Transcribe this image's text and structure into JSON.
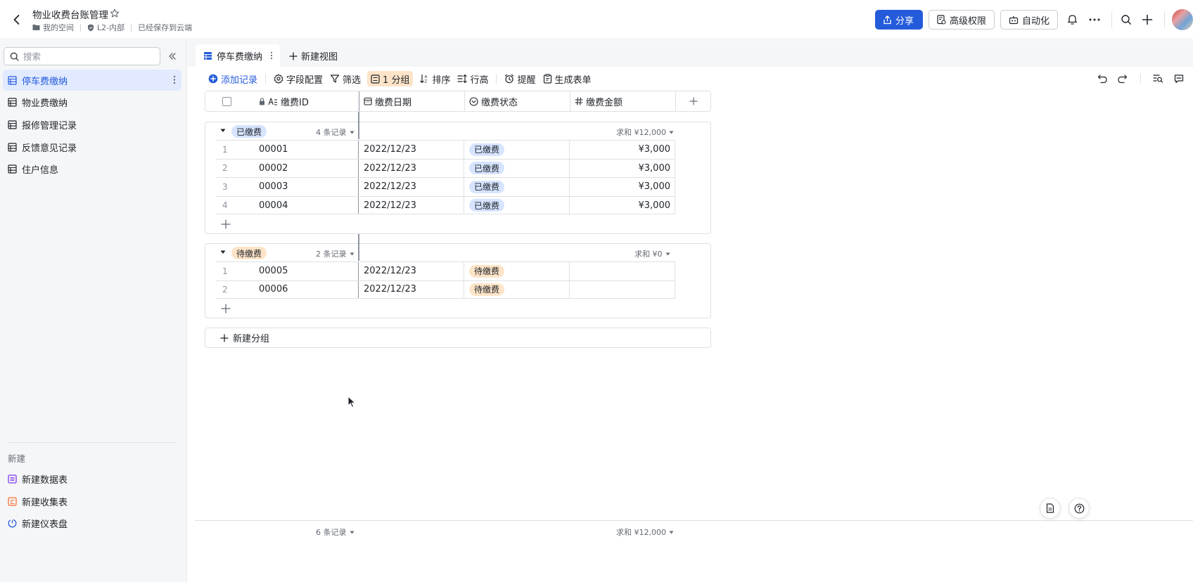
{
  "header": {
    "title": "物业收费台账管理",
    "location": "我的空间",
    "security": "L2-内部",
    "save_status": "已经保存到云端",
    "share_label": "分享",
    "permission_label": "高级权限",
    "automation_label": "自动化"
  },
  "sidebar": {
    "search_placeholder": "搜索",
    "items": [
      {
        "label": "停车费缴纳",
        "active": true
      },
      {
        "label": "物业费缴纳"
      },
      {
        "label": "报修管理记录"
      },
      {
        "label": "反馈意见记录"
      },
      {
        "label": "住户信息"
      }
    ],
    "new_title": "新建",
    "new_items": [
      {
        "label": "新建数据表",
        "icon": "table-icon",
        "color": "#7f3bf5"
      },
      {
        "label": "新建收集表",
        "icon": "form-icon",
        "color": "#f77234"
      },
      {
        "label": "新建仪表盘",
        "icon": "dashboard-icon",
        "color": "#245bdb"
      }
    ]
  },
  "tabs": {
    "active_label": "停车费缴纳",
    "new_view_label": "新建视图"
  },
  "toolbar": {
    "add_record": "添加记录",
    "field_config": "字段配置",
    "filter": "筛选",
    "group": "1 分组",
    "sort": "排序",
    "row_height": "行高",
    "reminder": "提醒",
    "generate_form": "生成表单"
  },
  "columns": {
    "id": "缴费ID",
    "date": "缴费日期",
    "status": "缴费状态",
    "amount": "缴费金额"
  },
  "groups": [
    {
      "tag": "已缴费",
      "count": "4 条记录",
      "sum": "求和 ¥12,000",
      "rows": [
        {
          "num": "1",
          "id": "00001",
          "date": "2022/12/23",
          "status": "已缴费",
          "amount": "¥3,000"
        },
        {
          "num": "2",
          "id": "00002",
          "date": "2022/12/23",
          "status": "已缴费",
          "amount": "¥3,000"
        },
        {
          "num": "3",
          "id": "00003",
          "date": "2022/12/23",
          "status": "已缴费",
          "amount": "¥3,000"
        },
        {
          "num": "4",
          "id": "00004",
          "date": "2022/12/23",
          "status": "已缴费",
          "amount": "¥3,000"
        }
      ]
    },
    {
      "tag": "待缴费",
      "count": "2 条记录",
      "sum": "求和 ¥0",
      "rows": [
        {
          "num": "1",
          "id": "00005",
          "date": "2022/12/23",
          "status": "待缴费",
          "amount": ""
        },
        {
          "num": "2",
          "id": "00006",
          "date": "2022/12/23",
          "status": "待缴费",
          "amount": ""
        }
      ]
    }
  ],
  "new_group_label": "新建分组",
  "footer": {
    "count": "6 条记录",
    "sum": "求和 ¥12,000"
  },
  "colors": {
    "accent": "#245bdb",
    "paid_tag": "#d6e4ff",
    "pending_tag": "#fde4c8",
    "active_nav": "#e1eaff"
  }
}
